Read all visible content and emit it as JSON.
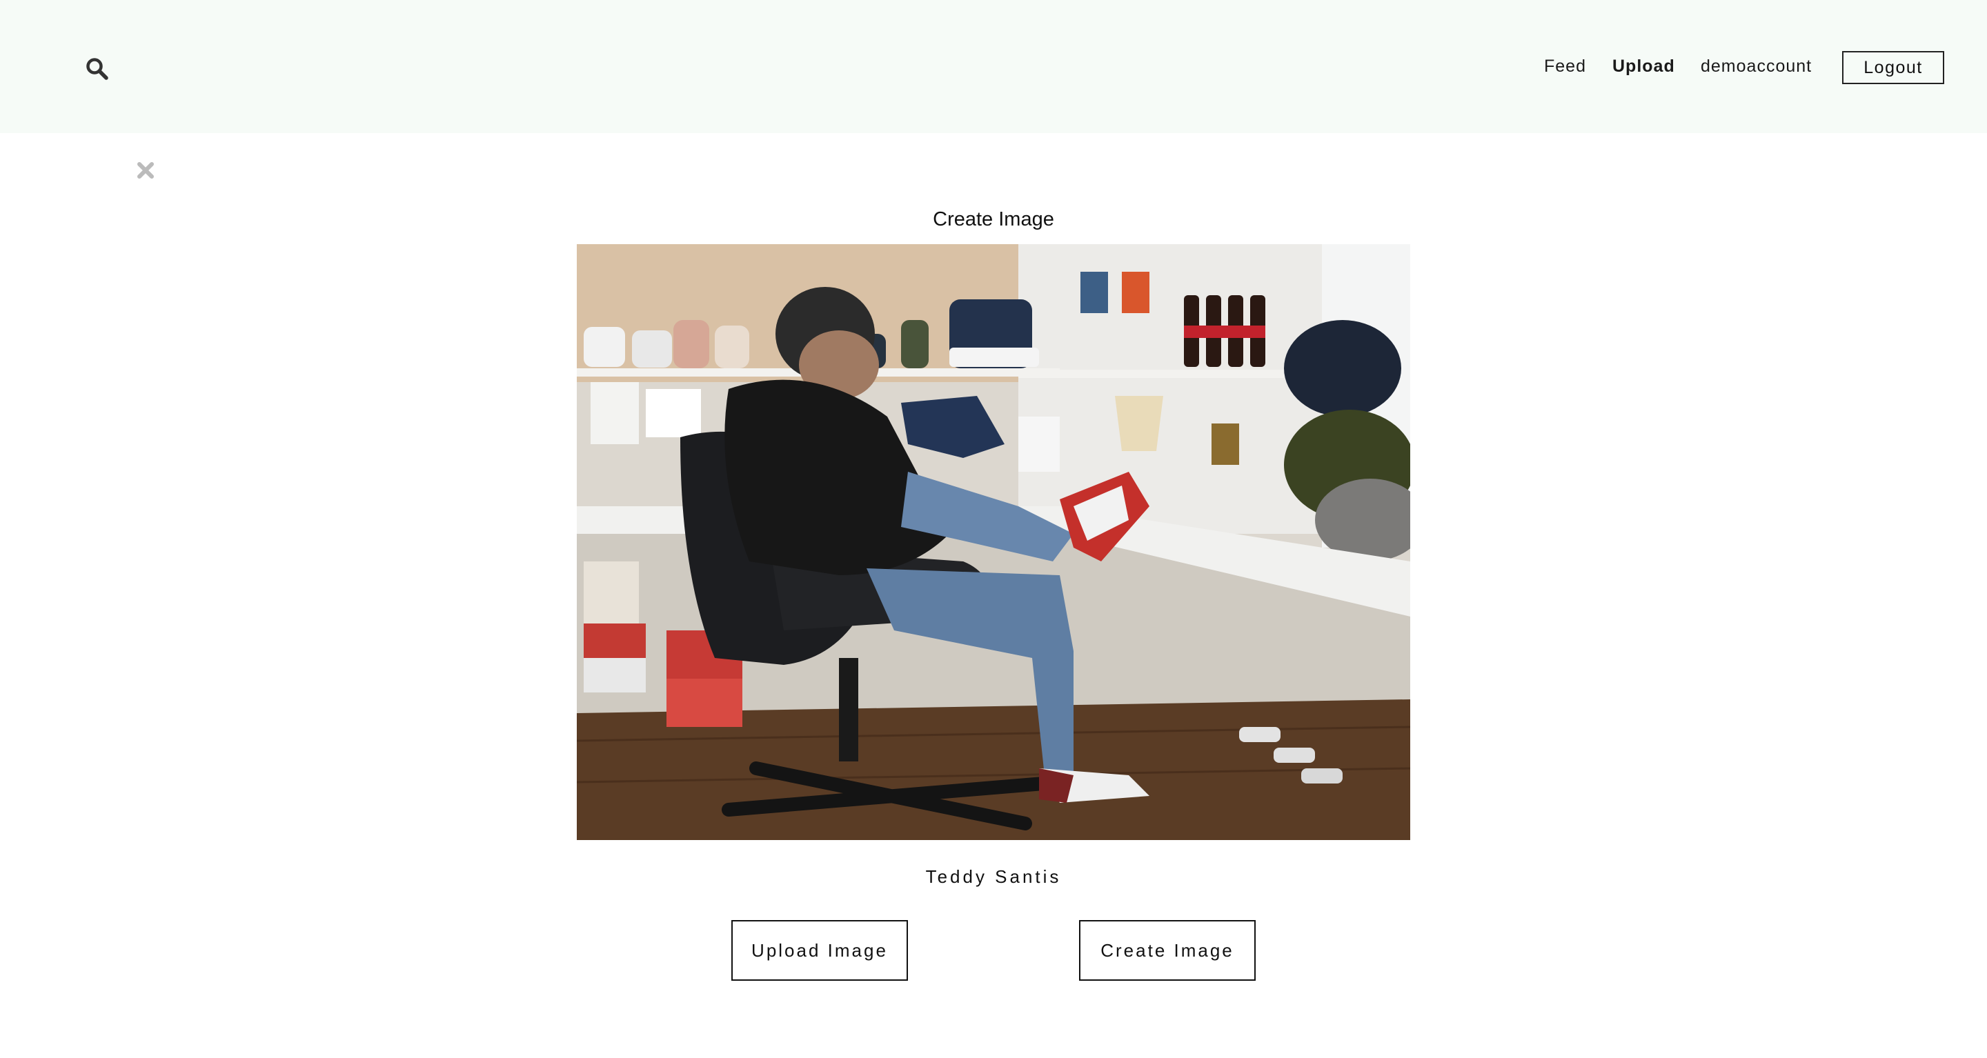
{
  "header": {
    "nav": {
      "feed": "Feed",
      "upload": "Upload",
      "account": "demoaccount",
      "logout": "Logout"
    }
  },
  "icons": {
    "search": "search-icon",
    "close": "close-icon"
  },
  "main": {
    "title": "Create Image",
    "image_alt": "Man in a black hoodie and beanie on the phone, sitting in a leather office chair with his sneaker on a desk in a studio full of sneakers",
    "caption": "Teddy Santis",
    "buttons": {
      "upload": "Upload Image",
      "create": "Create Image"
    }
  },
  "colors": {
    "header_bg": "#f6fbf7",
    "text": "#111111",
    "close_icon": "#bbbbbb"
  }
}
